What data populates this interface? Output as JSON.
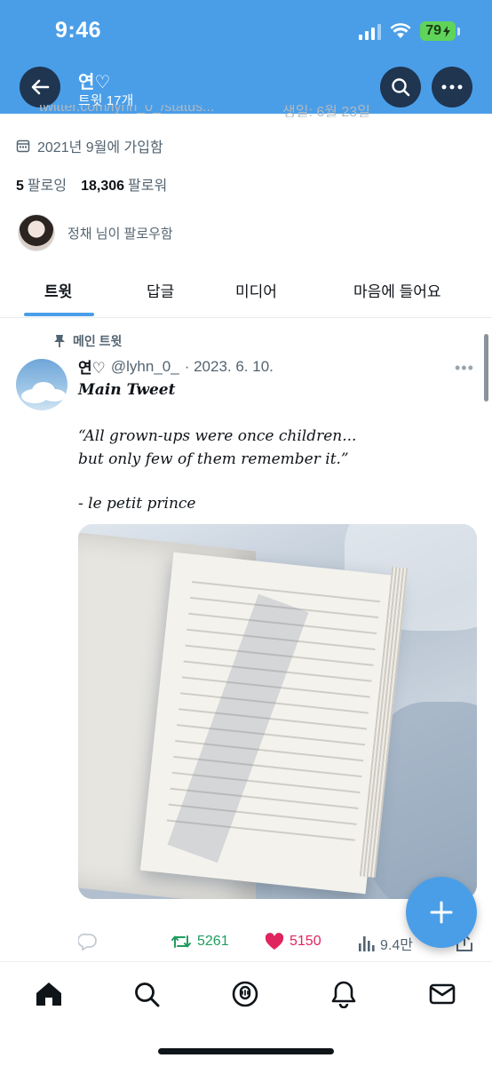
{
  "status_bar": {
    "time": "9:46",
    "battery": "79"
  },
  "header": {
    "name": "연♡",
    "subtitle": "트윗 17개"
  },
  "profile": {
    "cut_row_left": "twitter.com/lyhn_0_/status...",
    "cut_row_right": "생일: 6월 23일",
    "joined": "2021년 9월에 가입함",
    "following_count": "5",
    "following_label": "팔로잉",
    "followers_count": "18,306",
    "followers_label": "팔로워",
    "followed_by": "정채 님이 팔로우함"
  },
  "tabs": [
    "트윗",
    "답글",
    "미디어",
    "마음에 들어요"
  ],
  "tweet": {
    "pinned_label": "메인 트윗",
    "name": "연♡",
    "handle": "@lyhn_0_",
    "date": "· 2023. 6. 10.",
    "line1": "Main Tweet",
    "line2": "“All grown-ups were once children...",
    "line3": "but only few of them remember it.”",
    "line4": "- le petit prince",
    "retweets": "5261",
    "likes": "5150",
    "views": "9.4만"
  },
  "colors": {
    "accent": "#4a9ee8",
    "retweet": "#1f9d5d",
    "like": "#e0245e",
    "battery": "#5fd35a"
  },
  "icons": [
    "back-arrow-icon",
    "search-icon",
    "more-icon",
    "calendar-icon",
    "pin-icon",
    "reply-icon",
    "retweet-icon",
    "heart-icon",
    "views-icon",
    "share-icon",
    "compose-plus-icon",
    "home-icon",
    "explore-icon",
    "spaces-icon",
    "notifications-icon",
    "messages-icon"
  ]
}
